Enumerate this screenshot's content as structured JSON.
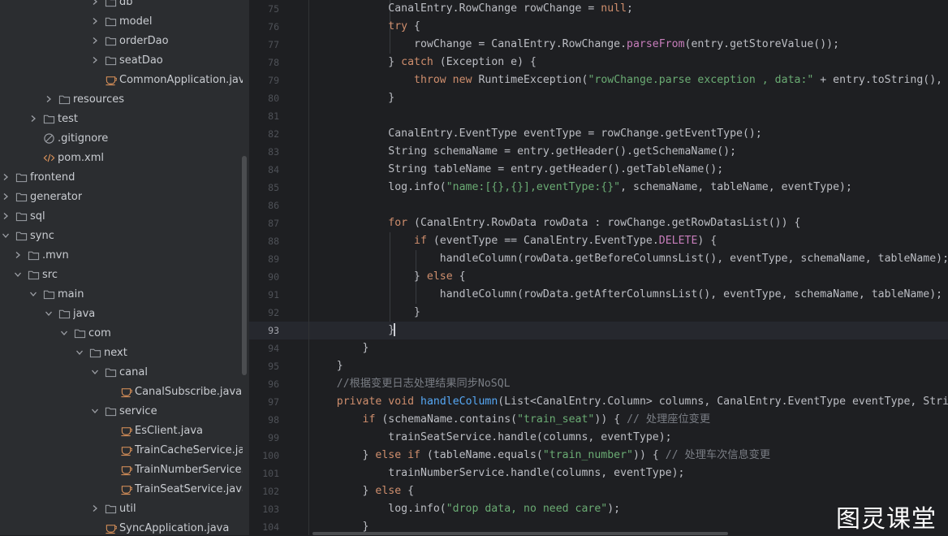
{
  "tree": [
    {
      "label": "db",
      "depth": 6,
      "chevron": "collapsed",
      "icon": "folder"
    },
    {
      "label": "model",
      "depth": 6,
      "chevron": "collapsed",
      "icon": "folder"
    },
    {
      "label": "orderDao",
      "depth": 6,
      "chevron": "collapsed",
      "icon": "folder"
    },
    {
      "label": "seatDao",
      "depth": 6,
      "chevron": "collapsed",
      "icon": "folder"
    },
    {
      "label": "CommonApplication.java",
      "depth": 6,
      "chevron": "none",
      "icon": "java-class"
    },
    {
      "label": "resources",
      "depth": 3,
      "chevron": "collapsed",
      "icon": "folder"
    },
    {
      "label": "test",
      "depth": 2,
      "chevron": "collapsed",
      "icon": "folder"
    },
    {
      "label": ".gitignore",
      "depth": 2,
      "chevron": "none",
      "icon": "ignore-file"
    },
    {
      "label": "pom.xml",
      "depth": 2,
      "chevron": "none",
      "icon": "xml-file"
    },
    {
      "label": "frontend",
      "depth": 0,
      "chevron": "collapsed",
      "icon": "folder"
    },
    {
      "label": "generator",
      "depth": 0,
      "chevron": "collapsed",
      "icon": "folder"
    },
    {
      "label": "sql",
      "depth": 0,
      "chevron": "collapsed",
      "icon": "folder"
    },
    {
      "label": "sync",
      "depth": 0,
      "chevron": "expanded",
      "icon": "folder"
    },
    {
      "label": ".mvn",
      "depth": 1,
      "chevron": "collapsed",
      "icon": "folder"
    },
    {
      "label": "src",
      "depth": 1,
      "chevron": "expanded",
      "icon": "folder"
    },
    {
      "label": "main",
      "depth": 2,
      "chevron": "expanded",
      "icon": "folder"
    },
    {
      "label": "java",
      "depth": 3,
      "chevron": "expanded",
      "icon": "folder"
    },
    {
      "label": "com",
      "depth": 4,
      "chevron": "expanded",
      "icon": "folder"
    },
    {
      "label": "next",
      "depth": 5,
      "chevron": "expanded",
      "icon": "folder"
    },
    {
      "label": "canal",
      "depth": 6,
      "chevron": "expanded",
      "icon": "folder"
    },
    {
      "label": "CanalSubscribe.java",
      "depth": 7,
      "chevron": "none",
      "icon": "java-class"
    },
    {
      "label": "service",
      "depth": 6,
      "chevron": "expanded",
      "icon": "folder"
    },
    {
      "label": "EsClient.java",
      "depth": 7,
      "chevron": "none",
      "icon": "java-class"
    },
    {
      "label": "TrainCacheService.java",
      "depth": 7,
      "chevron": "none",
      "icon": "java-class"
    },
    {
      "label": "TrainNumberService.java",
      "depth": 7,
      "chevron": "none",
      "icon": "java-class"
    },
    {
      "label": "TrainSeatService.java",
      "depth": 7,
      "chevron": "none",
      "icon": "java-class"
    },
    {
      "label": "util",
      "depth": 6,
      "chevron": "collapsed",
      "icon": "folder"
    },
    {
      "label": "SyncApplication.java",
      "depth": 6,
      "chevron": "none",
      "icon": "java-class"
    }
  ],
  "editor": {
    "current_line": 93,
    "lines": [
      {
        "n": 75,
        "t": [
          [
            "            CanalEntry.RowChange rowChange = ",
            ""
          ],
          [
            "null",
            "k"
          ],
          [
            ";",
            ""
          ]
        ]
      },
      {
        "n": 76,
        "t": [
          [
            "            ",
            ""
          ],
          [
            "try",
            "k"
          ],
          [
            " {",
            ""
          ]
        ]
      },
      {
        "n": 77,
        "t": [
          [
            "                rowChange = CanalEntry.RowChange.",
            ""
          ],
          [
            "parseFrom",
            "p"
          ],
          [
            "(entry.getStoreValue());",
            ""
          ]
        ]
      },
      {
        "n": 78,
        "t": [
          [
            "            } ",
            ""
          ],
          [
            "catch",
            "k"
          ],
          [
            " (Exception e) {",
            ""
          ]
        ]
      },
      {
        "n": 79,
        "t": [
          [
            "                ",
            ""
          ],
          [
            "throw new",
            "k"
          ],
          [
            " RuntimeException(",
            ""
          ],
          [
            "\"rowChange.parse exception , data:\"",
            "s"
          ],
          [
            " + entry.toString(), e);",
            ""
          ]
        ]
      },
      {
        "n": 80,
        "t": [
          [
            "            }",
            ""
          ]
        ]
      },
      {
        "n": 81,
        "t": [
          [
            "",
            ""
          ]
        ]
      },
      {
        "n": 82,
        "t": [
          [
            "            CanalEntry.EventType eventType = rowChange.getEventType();",
            ""
          ]
        ]
      },
      {
        "n": 83,
        "t": [
          [
            "            String schemaName = entry.getHeader().getSchemaName();",
            ""
          ]
        ]
      },
      {
        "n": 84,
        "t": [
          [
            "            String tableName = entry.getHeader().getTableName();",
            ""
          ]
        ]
      },
      {
        "n": 85,
        "t": [
          [
            "            log.info(",
            ""
          ],
          [
            "\"name:[{},{}],eventType:{}\"",
            "s"
          ],
          [
            ", schemaName, tableName, eventType);",
            ""
          ]
        ]
      },
      {
        "n": 86,
        "t": [
          [
            "",
            ""
          ]
        ]
      },
      {
        "n": 87,
        "t": [
          [
            "            ",
            ""
          ],
          [
            "for",
            "k"
          ],
          [
            " (CanalEntry.RowData rowData : rowChange.getRowDatasList()) {",
            ""
          ]
        ]
      },
      {
        "n": 88,
        "t": [
          [
            "                ",
            ""
          ],
          [
            "if",
            "k"
          ],
          [
            " (eventType == CanalEntry.EventType.",
            ""
          ],
          [
            "DELETE",
            "p"
          ],
          [
            ") {",
            ""
          ]
        ]
      },
      {
        "n": 89,
        "t": [
          [
            "                    handleColumn(rowData.getBeforeColumnsList(), eventType, schemaName, tableName);",
            ""
          ]
        ]
      },
      {
        "n": 90,
        "t": [
          [
            "                } ",
            ""
          ],
          [
            "else",
            "k"
          ],
          [
            " {",
            ""
          ]
        ]
      },
      {
        "n": 91,
        "t": [
          [
            "                    handleColumn(rowData.getAfterColumnsList(), eventType, schemaName, tableName);",
            ""
          ]
        ]
      },
      {
        "n": 92,
        "t": [
          [
            "                }",
            ""
          ]
        ]
      },
      {
        "n": 93,
        "t": [
          [
            "            }",
            ""
          ]
        ]
      },
      {
        "n": 94,
        "t": [
          [
            "        }",
            ""
          ]
        ]
      },
      {
        "n": 95,
        "t": [
          [
            "    }",
            ""
          ]
        ]
      },
      {
        "n": 96,
        "t": [
          [
            "    ",
            ""
          ],
          [
            "//根据变更日志处理结果同步NoSQL",
            "c"
          ]
        ]
      },
      {
        "n": 97,
        "t": [
          [
            "    ",
            ""
          ],
          [
            "private void",
            "k"
          ],
          [
            " ",
            ""
          ],
          [
            "handleColumn",
            "f"
          ],
          [
            "(List<CanalEntry.Column> columns, CanalEntry.EventType eventType, String schemaName, String tableName) {",
            ""
          ]
        ]
      },
      {
        "n": 98,
        "t": [
          [
            "        ",
            ""
          ],
          [
            "if",
            "k"
          ],
          [
            " (schemaName.contains(",
            ""
          ],
          [
            "\"train_seat\"",
            "s"
          ],
          [
            ")) { ",
            ""
          ],
          [
            "// 处理座位变更",
            "c"
          ]
        ]
      },
      {
        "n": 99,
        "t": [
          [
            "            trainSeatService.handle(columns, eventType);",
            ""
          ]
        ]
      },
      {
        "n": 100,
        "t": [
          [
            "        } ",
            ""
          ],
          [
            "else if",
            "k"
          ],
          [
            " (tableName.equals(",
            ""
          ],
          [
            "\"train_number\"",
            "s"
          ],
          [
            ")) { ",
            ""
          ],
          [
            "// 处理车次信息变更",
            "c"
          ]
        ]
      },
      {
        "n": 101,
        "t": [
          [
            "            trainNumberService.handle(columns, eventType);",
            ""
          ]
        ]
      },
      {
        "n": 102,
        "t": [
          [
            "        } ",
            ""
          ],
          [
            "else",
            "k"
          ],
          [
            " {",
            ""
          ]
        ]
      },
      {
        "n": 103,
        "t": [
          [
            "            log.info(",
            ""
          ],
          [
            "\"drop data, no need care\"",
            "s"
          ],
          [
            ");",
            ""
          ]
        ]
      },
      {
        "n": 104,
        "t": [
          [
            "        }",
            ""
          ]
        ]
      }
    ]
  },
  "watermark": "图灵课堂",
  "colors": {
    "sidebar_bg": "#2b2d30",
    "editor_bg": "#1e1f22",
    "keyword": "#cf8e6d",
    "string": "#6aab73",
    "comment": "#7a7e85",
    "method": "#56a8f5",
    "static_member": "#c77dbb",
    "folder_icon": "#9da0a6",
    "java_icon": "#e0955b"
  }
}
